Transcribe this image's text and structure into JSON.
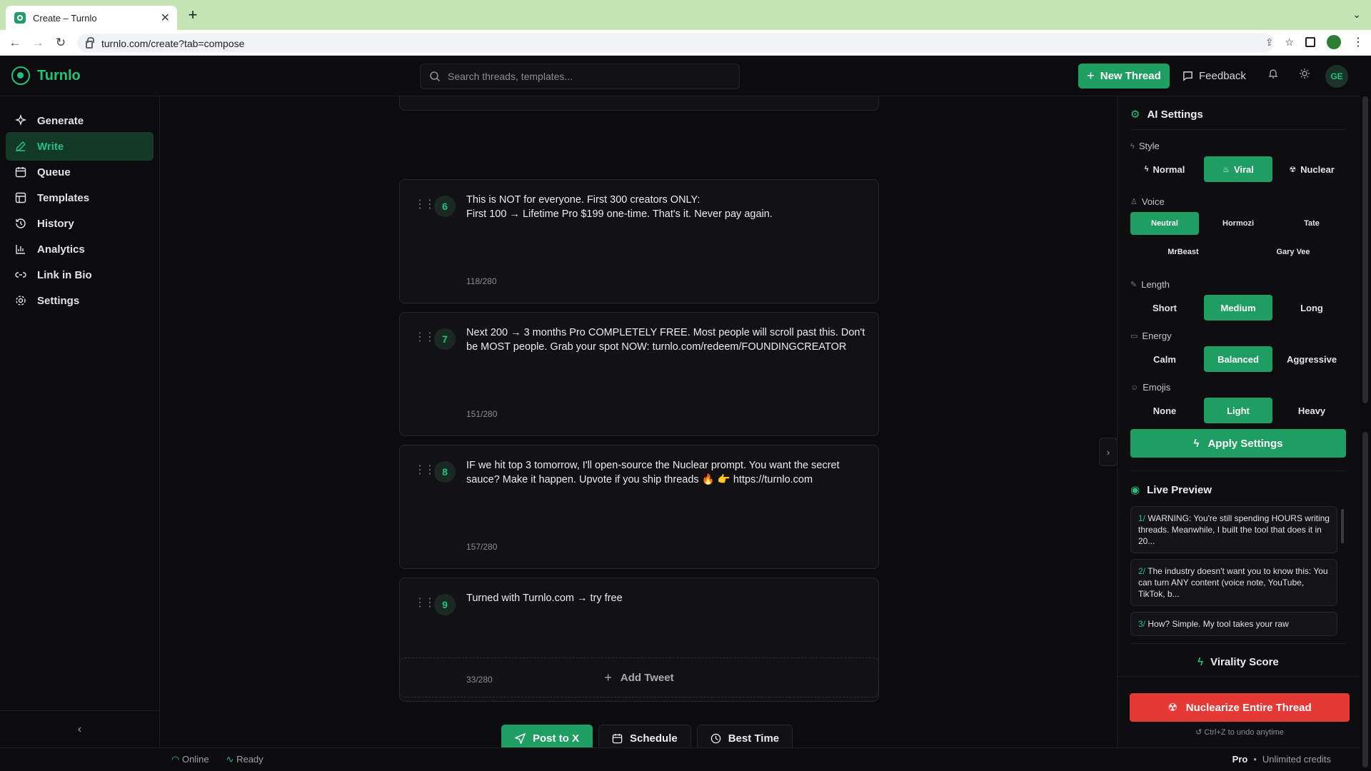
{
  "browser": {
    "tab_title": "Create – Turnlo",
    "url": "turnlo.com/create?tab=compose"
  },
  "header": {
    "brand": "Turnlo",
    "search_placeholder": "Search threads, templates...",
    "new_thread": "New Thread",
    "feedback": "Feedback",
    "avatar_initials": "GE"
  },
  "sidebar": {
    "items": [
      {
        "label": "Generate",
        "icon": "sparkle-icon"
      },
      {
        "label": "Write",
        "icon": "pen-icon",
        "active": true
      },
      {
        "label": "Queue",
        "icon": "calendar-icon"
      },
      {
        "label": "Templates",
        "icon": "layout-icon"
      },
      {
        "label": "History",
        "icon": "history-icon"
      },
      {
        "label": "Analytics",
        "icon": "bar-chart-icon"
      },
      {
        "label": "Link in Bio",
        "icon": "link-icon"
      },
      {
        "label": "Settings",
        "icon": "gear-icon"
      }
    ]
  },
  "tweets": [
    {
      "num": "6",
      "text": "This is NOT for everyone. First 300 creators ONLY:\nFirst 100 → Lifetime Pro $199 one-time. That's it. Never pay again.",
      "count": "118/280"
    },
    {
      "num": "7",
      "text": "Next 200 → 3 months Pro COMPLETELY FREE. Most people will scroll past this. Don't be MOST people. Grab your spot NOW: turnlo.com/redeem/FOUNDINGCREATOR",
      "count": "151/280"
    },
    {
      "num": "8",
      "text": "IF we hit top 3 tomorrow, I'll open-source the Nuclear prompt. You want the secret sauce? Make it happen. Upvote if you ship threads 🔥 👉 https://turnlo.com",
      "count": "157/280"
    },
    {
      "num": "9",
      "text": "Turned with Turnlo.com → try free",
      "count": "33/280"
    }
  ],
  "editor": {
    "add_tweet": "Add Tweet",
    "post": "Post to X",
    "schedule": "Schedule",
    "best_time": "Best Time"
  },
  "ai_settings": {
    "title": "AI Settings",
    "style_label": "Style",
    "style_options": [
      "Normal",
      "Viral",
      "Nuclear"
    ],
    "style_selected": "Viral",
    "voice_label": "Voice",
    "voice_options": [
      "Neutral",
      "Hormozi",
      "Tate",
      "MrBeast",
      "Gary Vee"
    ],
    "voice_selected": "Neutral",
    "length_label": "Length",
    "length_options": [
      "Short",
      "Medium",
      "Long"
    ],
    "length_selected": "Medium",
    "energy_label": "Energy",
    "energy_options": [
      "Calm",
      "Balanced",
      "Aggressive"
    ],
    "energy_selected": "Balanced",
    "emojis_label": "Emojis",
    "emojis_options": [
      "None",
      "Light",
      "Heavy"
    ],
    "emojis_selected": "Light",
    "apply": "Apply Settings"
  },
  "live_preview": {
    "title": "Live Preview",
    "items": [
      {
        "num": "1/",
        "text": "WARNING: You're still spending HOURS writing threads. Meanwhile, I built the tool that does it in 20..."
      },
      {
        "num": "2/",
        "text": "The industry doesn't want you to know this: You can turn ANY content (voice note, YouTube, TikTok, b..."
      },
      {
        "num": "3/",
        "text": "How? Simple. My tool takes your raw"
      }
    ]
  },
  "virality": {
    "title": "Virality Score"
  },
  "nuke": {
    "label": "Nuclearize Entire Thread",
    "undo": "Ctrl+Z to undo anytime"
  },
  "status": {
    "online": "Online",
    "ready": "Ready",
    "plan": "Pro",
    "sep": "•",
    "credits": "Unlimited credits"
  },
  "colors": {
    "accent": "#1e9e63",
    "accent_text": "#22c17c",
    "danger": "#e53935",
    "bg": "#0c0c0e"
  }
}
